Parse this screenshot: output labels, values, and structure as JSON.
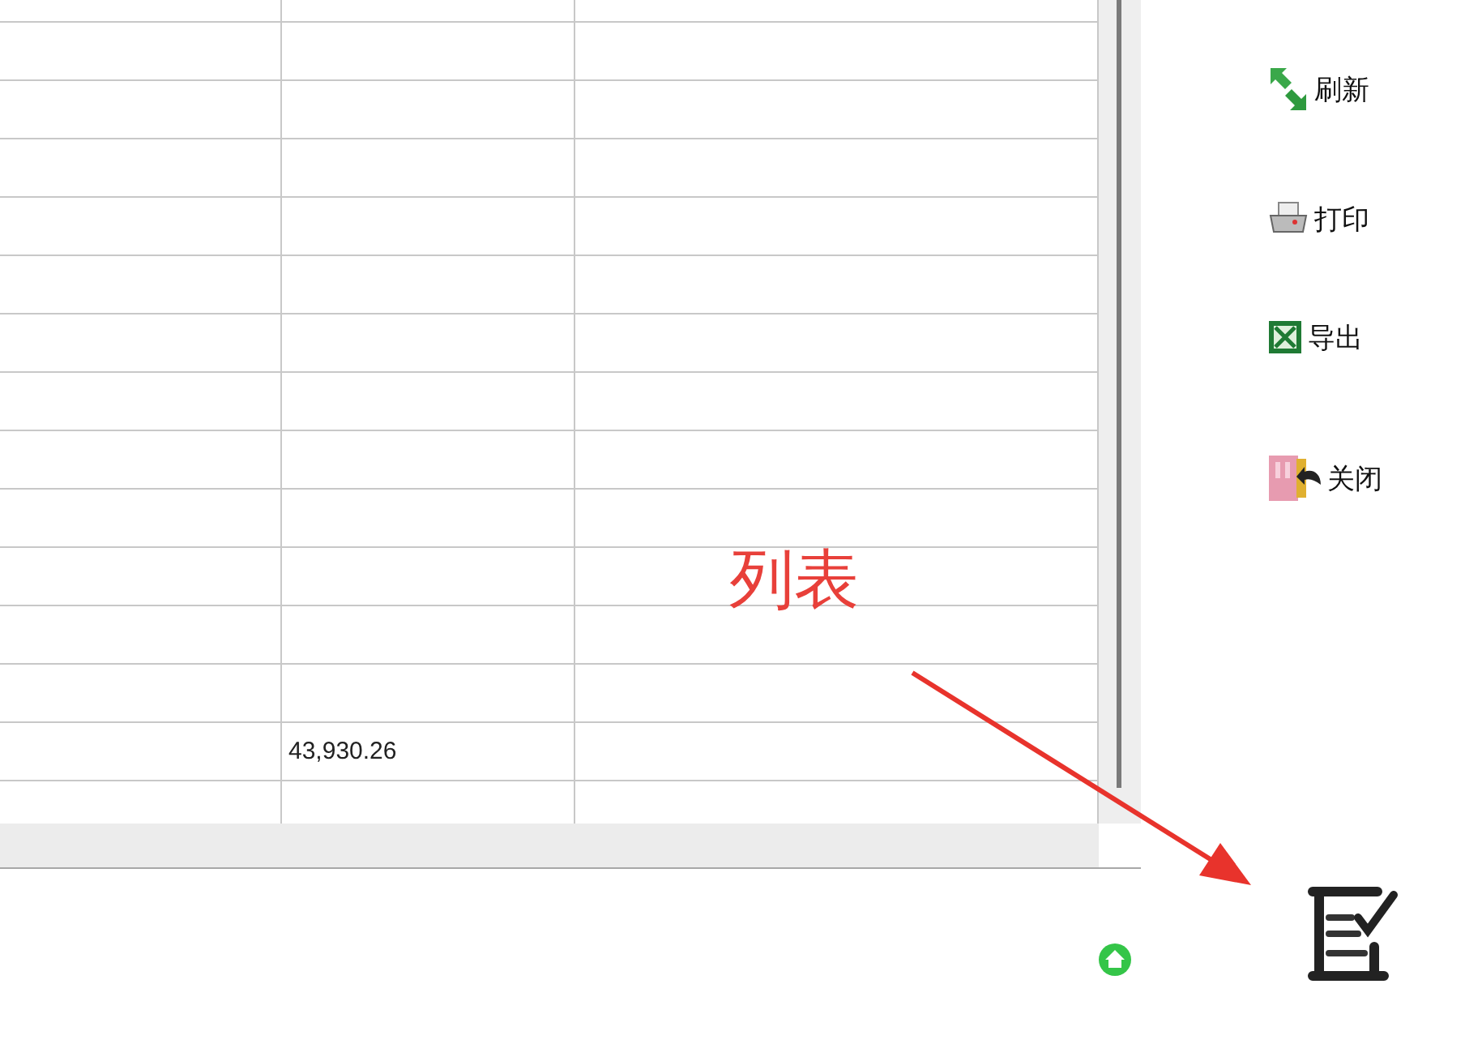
{
  "table": {
    "rows": [
      {
        "column_2": "43,930.26"
      }
    ]
  },
  "toolbar": [
    {
      "kind": "refresh",
      "label": "刷新"
    },
    {
      "kind": "print",
      "label": "打印"
    },
    {
      "kind": "export",
      "label": "导出"
    },
    {
      "kind": "close",
      "label": "关闭"
    }
  ],
  "annotation": {
    "label": "列表"
  }
}
